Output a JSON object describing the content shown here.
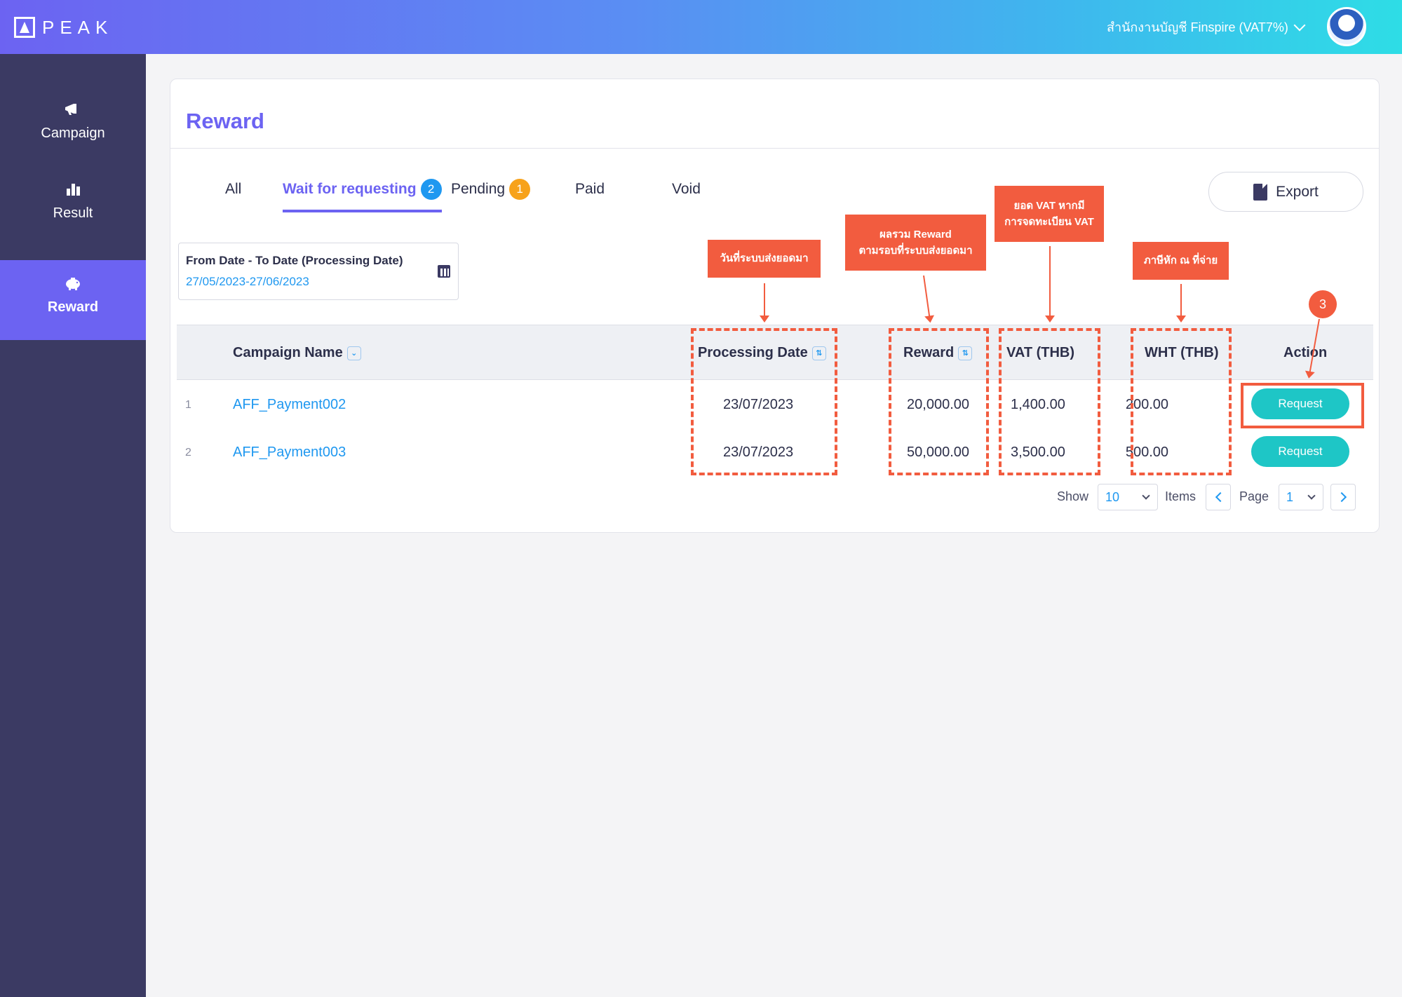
{
  "header": {
    "logo_text": "PEAK",
    "company": "สำนักงานบัญชี Finspire (VAT7%)"
  },
  "sidebar": {
    "items": [
      {
        "label": "Campaign",
        "icon": "megaphone-icon"
      },
      {
        "label": "Result",
        "icon": "bar-chart-icon"
      },
      {
        "label": "Reward",
        "icon": "piggy-bank-icon",
        "active": true
      }
    ]
  },
  "page": {
    "title": "Reward",
    "tabs": [
      {
        "label": "All"
      },
      {
        "label": "Wait for requesting",
        "badge": "2",
        "active": true
      },
      {
        "label": "Pending",
        "badge": "1"
      },
      {
        "label": "Paid"
      },
      {
        "label": "Void"
      }
    ],
    "export_label": "Export",
    "date_filter": {
      "label": "From Date - To Date (Processing Date)",
      "value": "27/05/2023-27/06/2023"
    }
  },
  "table": {
    "columns": {
      "campaign": "Campaign Name",
      "processing_date": "Processing Date",
      "reward": "Reward",
      "vat": "VAT (THB)",
      "wht": "WHT (THB)",
      "action": "Action"
    },
    "rows": [
      {
        "idx": "1",
        "campaign": "AFF_Payment002",
        "processing_date": "23/07/2023",
        "reward": "20,000.00",
        "vat": "1,400.00",
        "wht": "200.00",
        "action": "Request"
      },
      {
        "idx": "2",
        "campaign": "AFF_Payment003",
        "processing_date": "23/07/2023",
        "reward": "50,000.00",
        "vat": "3,500.00",
        "wht": "500.00",
        "action": "Request"
      }
    ]
  },
  "pager": {
    "show_label": "Show",
    "page_size": "10",
    "items_label": "Items",
    "page_label": "Page",
    "page": "1"
  },
  "annotations": {
    "processing_date": "วันที่ระบบส่งยอดมา",
    "reward_line1": "ผลรวม Reward",
    "reward_line2": "ตามรอบที่ระบบส่งยอดมา",
    "vat_line1": "ยอด VAT หากมี",
    "vat_line2": "การจดทะเบียน VAT",
    "wht": "ภาษีหัก ณ ที่จ่าย",
    "step": "3"
  },
  "colors": {
    "accent": "#6c63f2",
    "sidebar": "#3b3a63",
    "link": "#1f98f0",
    "request_button": "#1ec6c6",
    "annotation": "#f25c3f"
  }
}
